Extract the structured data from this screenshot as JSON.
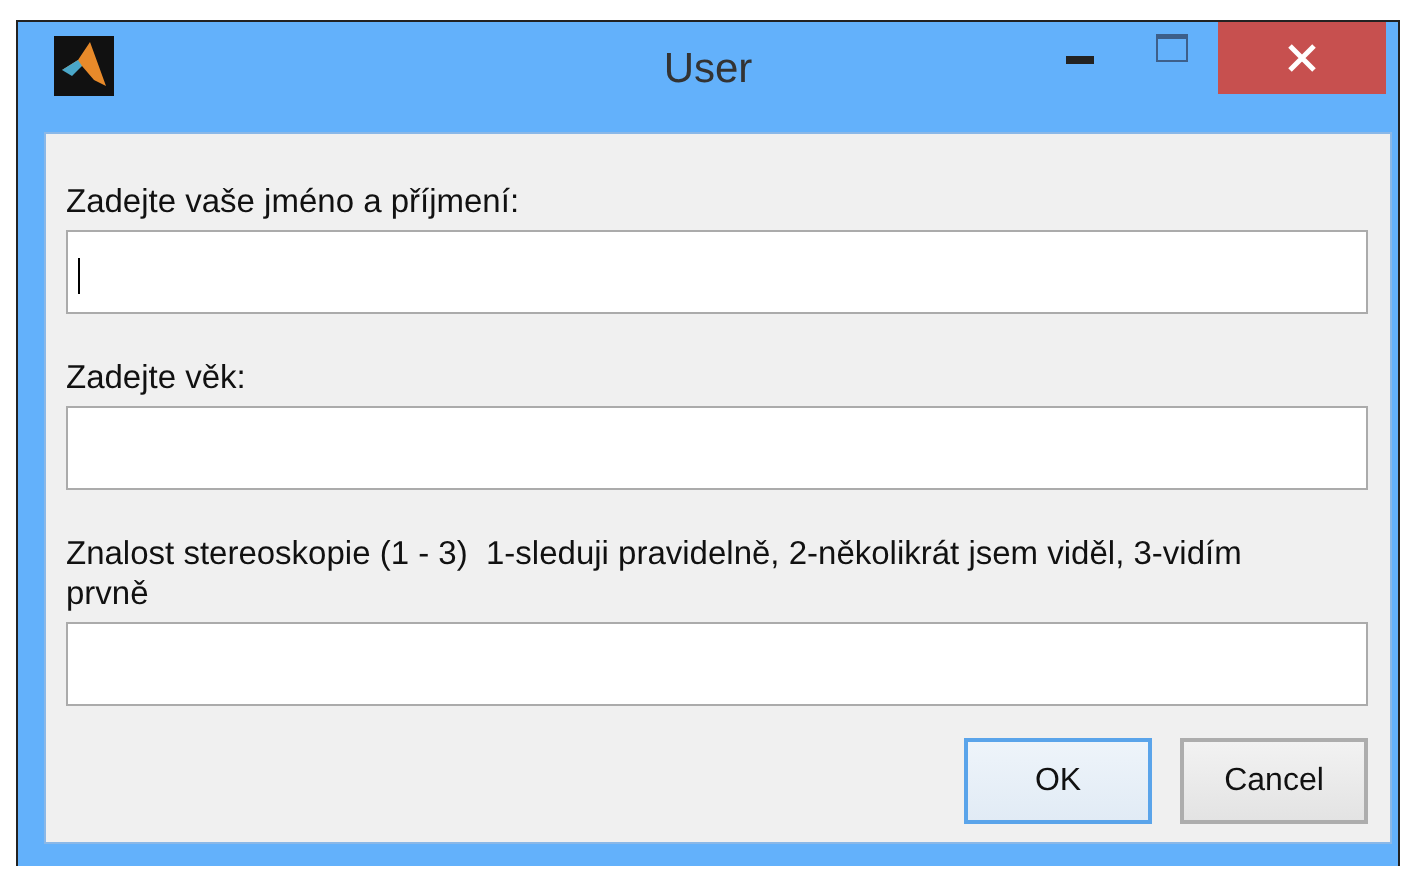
{
  "window": {
    "title": "User"
  },
  "fields": [
    {
      "label": "Zadejte vaše jméno a příjmení:",
      "focused": true
    },
    {
      "label": "Zadejte věk:",
      "focused": false
    },
    {
      "label": "Znalost stereoskopie (1 - 3)  1-sleduji pravidelně, 2-několikrát jsem viděl, 3-vidím prvně",
      "focused": false
    }
  ],
  "buttons": [
    {
      "label": "OK",
      "default": true
    },
    {
      "label": "Cancel",
      "default": false
    }
  ]
}
